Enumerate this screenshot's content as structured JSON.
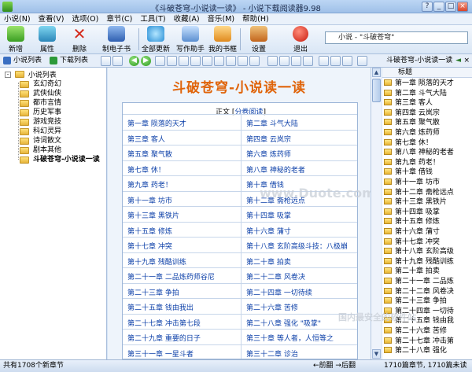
{
  "window": {
    "title": "《斗破苍穹-小说读一读》 - 小说下载阅读器9.98",
    "controls": [
      "?",
      "_",
      "□",
      "×"
    ]
  },
  "menu": [
    "小说(N)",
    "查看(V)",
    "选项(O)",
    "章节(C)",
    "工具(T)",
    "收藏(A)",
    "音乐(M)",
    "帮助(H)"
  ],
  "toolbar": {
    "new": "新增",
    "attr": "属性",
    "del": "删除",
    "ebook": "制电子书",
    "update": "全部更新",
    "assistant": "写作助手",
    "shelf": "我的书框",
    "settings": "设置",
    "exit": "退出"
  },
  "search": {
    "value": "小说 - \"斗破苍穹\""
  },
  "tabs": {
    "list": "小说列表",
    "download": "下载列表"
  },
  "tree": {
    "root": "小说列表",
    "items": [
      "玄幻奇幻",
      "武侠仙侠",
      "都市言情",
      "历史军事",
      "游戏竞技",
      "科幻灵异",
      "诗词散文",
      "剧本其他",
      "斗破苍穹-小说读一读"
    ]
  },
  "book": {
    "title": "斗破苍穹-小说读一读",
    "volume_prefix": "正文 [",
    "volume_link": "分卷阅读",
    "volume_suffix": "]"
  },
  "chapters": [
    [
      "第一章 陨落的天才",
      "第二章 斗气大陆"
    ],
    [
      "第三章 客人",
      "第四章 云岚宗"
    ],
    [
      "第五章 聚气散",
      "第六章 炼药师"
    ],
    [
      "第七章 休！",
      "第八章 神秘的老者"
    ],
    [
      "第九章 药老！",
      "第十章 借钱"
    ],
    [
      "第十一章 坊市",
      "第十二章 斋枪远点"
    ],
    [
      "第十三章 黑铁片",
      "第十四章 吸掌"
    ],
    [
      "第十五章 修炼",
      "第十六章 蒲寸"
    ],
    [
      "第十七章 冲突",
      "第十八章 玄阶高级斗技：八极崩"
    ],
    [
      "第十九章 残酷训练",
      "第二十章 拍卖"
    ],
    [
      "第二十一章 二品炼药师谷尼",
      "第二十二章 风卷决"
    ],
    [
      "第二十三章 争拍",
      "第二十四章 一切待续"
    ],
    [
      "第二十五章 钱由我出",
      "第二十六章 苦修"
    ],
    [
      "第二十七章 冲击第七段",
      "第二十八章 强化 \"吸掌\""
    ],
    [
      "第二十九章 重要的日子",
      "第三十章 等人者，人恒等之"
    ],
    [
      "第三十一章 一星斗者",
      "第三十二章 诊治"
    ]
  ],
  "right": {
    "header": "斗破苍穹-小说读一读",
    "column": "标题",
    "items": [
      "第一章 陨落的天才",
      "第二章 斗气大陆",
      "第三章 客人",
      "第四章 云岚宗",
      "第五章 聚气散",
      "第六章 炼药师",
      "第七章 休！",
      "第八章 神秘的老者",
      "第九章 药老！",
      "第十章 借钱",
      "第十一章 坊市",
      "第十二章 斋枪远点",
      "第十三章 黑铁片",
      "第十四章 吸掌",
      "第十五章 修炼",
      "第十六章 蒲寸",
      "第十七章 冲突",
      "第十八章 玄阶高级",
      "第十九章 残酷训练",
      "第二十章 拍卖",
      "第二十一章 二品炼",
      "第二十二章 风卷决",
      "第二十三章 争拍",
      "第二十四章 一切待",
      "第二十五章 钱由我",
      "第二十六章 苦修",
      "第二十七章 冲击第",
      "第二十八章 强化"
    ]
  },
  "watermark": {
    "main": "www.Duote.com",
    "corner": "国内最安全的软件站"
  },
  "status": {
    "left": "共有1708个新章节",
    "nav": "←前翻 →后翻",
    "right": "1710篇章节, 1710篇未读"
  },
  "colors": {
    "title": "#e0640a",
    "link": "#0b3fa8"
  }
}
